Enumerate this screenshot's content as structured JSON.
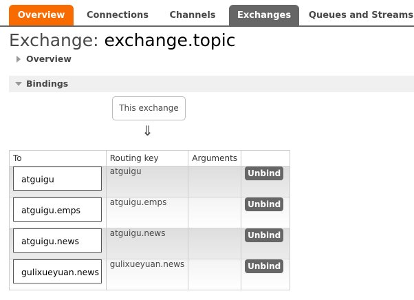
{
  "nav": {
    "tabs": [
      {
        "label": "Overview"
      },
      {
        "label": "Connections"
      },
      {
        "label": "Channels"
      },
      {
        "label": "Exchanges"
      },
      {
        "label": "Queues and Streams"
      }
    ]
  },
  "header": {
    "title_prefix": "Exchange:",
    "exchange_name": "exchange.topic"
  },
  "sections": {
    "overview_label": "Overview",
    "bindings_label": "Bindings"
  },
  "bindings": {
    "source_label": "This exchange",
    "arrow_glyph": "⇓",
    "columns": {
      "to": "To",
      "routing_key": "Routing key",
      "arguments": "Arguments"
    },
    "rows": [
      {
        "to": "atguigu",
        "routing_key": "atguigu",
        "arguments": "",
        "action": "Unbind"
      },
      {
        "to": "atguigu.emps",
        "routing_key": "atguigu.emps",
        "arguments": "",
        "action": "Unbind"
      },
      {
        "to": "atguigu.news",
        "routing_key": "atguigu.news",
        "arguments": "",
        "action": "Unbind"
      },
      {
        "to": "gulixueyuan.news",
        "routing_key": "gulixueyuan.news",
        "arguments": "",
        "action": "Unbind"
      }
    ]
  },
  "colors": {
    "accent_orange": "#f86b00",
    "tab_active_grey": "#666666",
    "button_grey": "#666666"
  }
}
